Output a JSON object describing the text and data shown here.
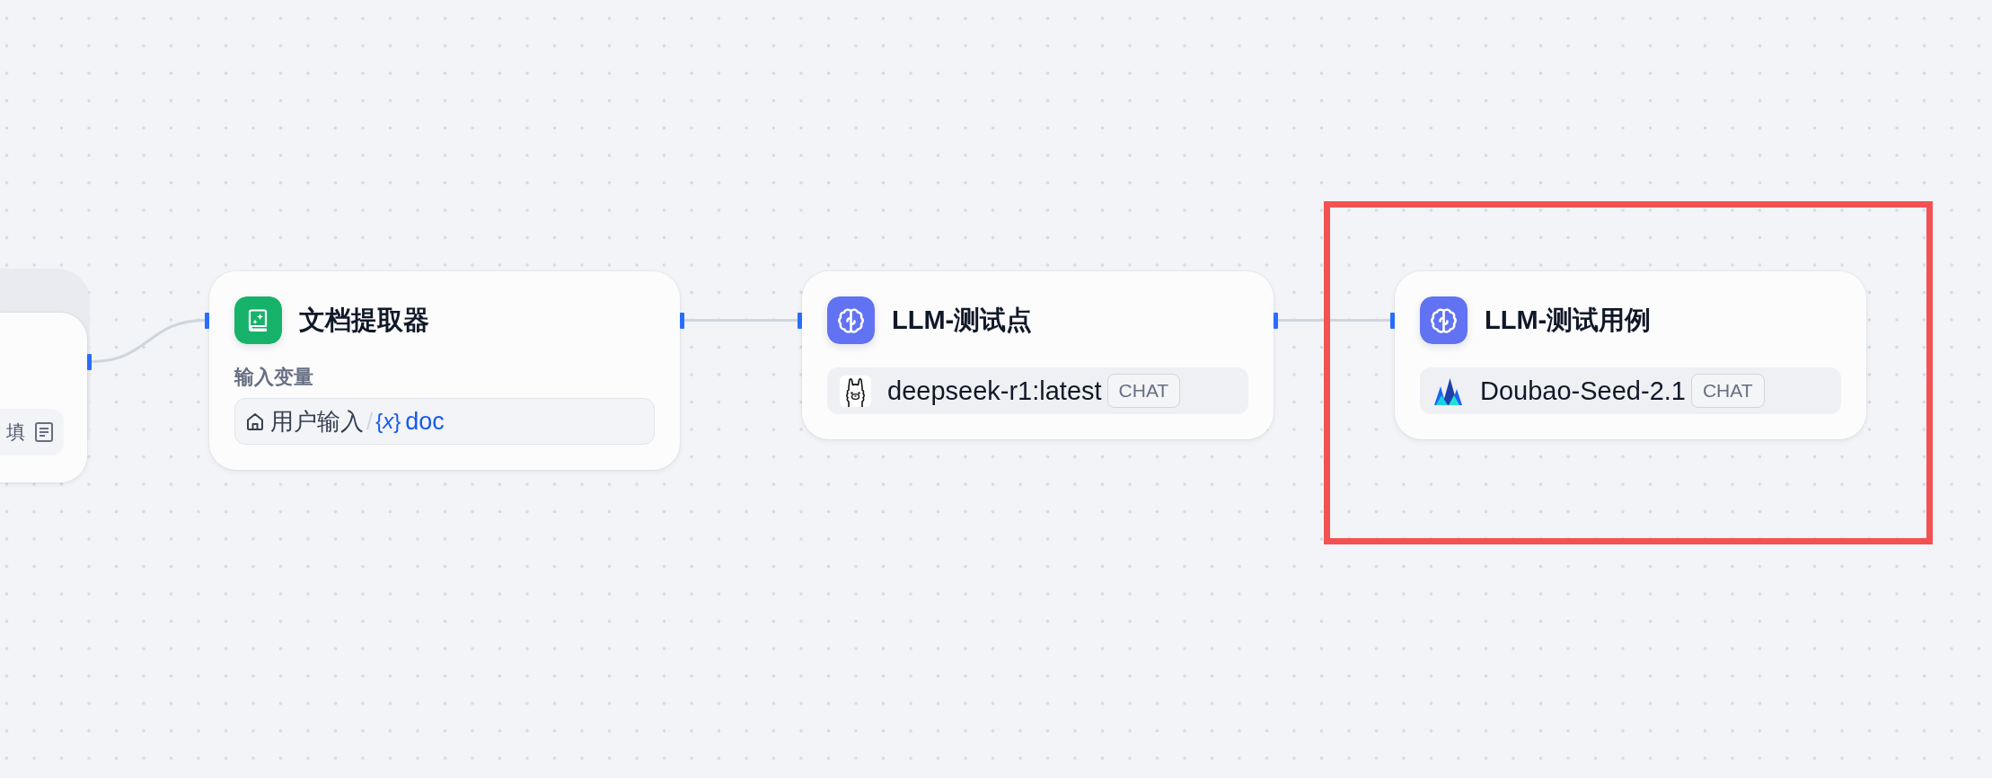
{
  "canvas": {
    "nodes": [
      {
        "kind": "partial",
        "highlighted": false,
        "tag": "填"
      },
      {
        "kind": "doc_extractor",
        "highlighted": false,
        "title": "文档提取器",
        "input_label": "输入变量",
        "variable": {
          "source": "用户输入",
          "separator": "/",
          "symbol": "{*x*}",
          "name": "doc"
        }
      },
      {
        "kind": "llm",
        "highlighted": false,
        "title": "LLM-测试点",
        "model": {
          "kind": "alpaca",
          "name": "deepseek-r1:latest",
          "mode": "CHAT"
        }
      },
      {
        "kind": "llm",
        "highlighted": true,
        "title": "LLM-测试用例",
        "model": {
          "kind": "peaks",
          "name": "Doubao-Seed-2.1",
          "mode": "CHAT"
        }
      }
    ]
  }
}
